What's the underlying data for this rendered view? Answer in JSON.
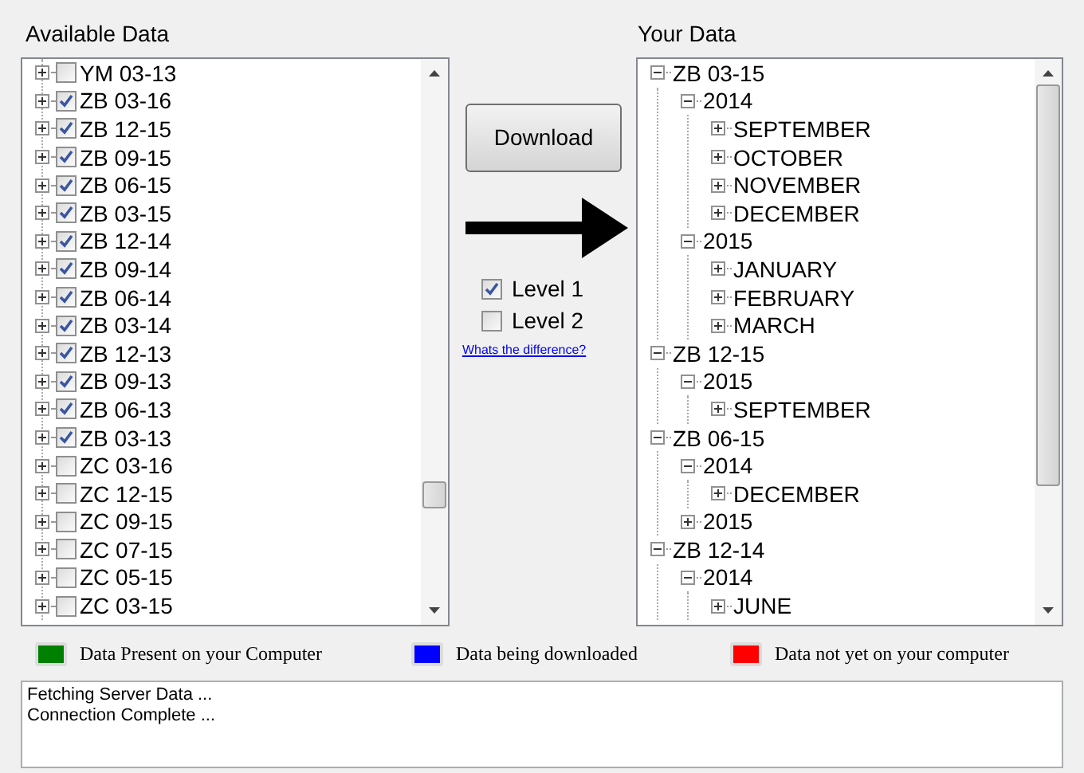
{
  "available_data": {
    "title": "Available Data",
    "items": [
      {
        "label": "YM 03-13",
        "checked": false
      },
      {
        "label": "ZB 03-16",
        "checked": true
      },
      {
        "label": "ZB 12-15",
        "checked": true
      },
      {
        "label": "ZB 09-15",
        "checked": true
      },
      {
        "label": "ZB 06-15",
        "checked": true
      },
      {
        "label": "ZB 03-15",
        "checked": true
      },
      {
        "label": "ZB 12-14",
        "checked": true
      },
      {
        "label": "ZB 09-14",
        "checked": true
      },
      {
        "label": "ZB 06-14",
        "checked": true
      },
      {
        "label": "ZB 03-14",
        "checked": true
      },
      {
        "label": "ZB 12-13",
        "checked": true
      },
      {
        "label": "ZB 09-13",
        "checked": true
      },
      {
        "label": "ZB 06-13",
        "checked": true
      },
      {
        "label": "ZB 03-13",
        "checked": true
      },
      {
        "label": "ZC 03-16",
        "checked": false
      },
      {
        "label": "ZC 12-15",
        "checked": false
      },
      {
        "label": "ZC 09-15",
        "checked": false
      },
      {
        "label": "ZC 07-15",
        "checked": false
      },
      {
        "label": "ZC 05-15",
        "checked": false
      },
      {
        "label": "ZC 03-15",
        "checked": false
      }
    ]
  },
  "download_button": "Download",
  "levels": [
    {
      "label": "Level 1",
      "checked": true
    },
    {
      "label": "Level 2",
      "checked": false
    }
  ],
  "difference_link": "Whats the difference?",
  "your_data": {
    "title": "Your Data",
    "tree": [
      {
        "label": "ZB 03-15",
        "expanded": true,
        "children": [
          {
            "label": "2014",
            "expanded": true,
            "children": [
              {
                "label": "SEPTEMBER",
                "expanded": false
              },
              {
                "label": "OCTOBER",
                "expanded": false
              },
              {
                "label": "NOVEMBER",
                "expanded": false
              },
              {
                "label": "DECEMBER",
                "expanded": false
              }
            ]
          },
          {
            "label": "2015",
            "expanded": true,
            "children": [
              {
                "label": "JANUARY",
                "expanded": false
              },
              {
                "label": "FEBRUARY",
                "expanded": false
              },
              {
                "label": "MARCH",
                "expanded": false
              }
            ]
          }
        ]
      },
      {
        "label": "ZB 12-15",
        "expanded": true,
        "children": [
          {
            "label": "2015",
            "expanded": true,
            "children": [
              {
                "label": "SEPTEMBER",
                "expanded": false
              }
            ]
          }
        ]
      },
      {
        "label": "ZB 06-15",
        "expanded": true,
        "children": [
          {
            "label": "2014",
            "expanded": true,
            "children": [
              {
                "label": "DECEMBER",
                "expanded": false
              }
            ]
          },
          {
            "label": "2015",
            "expanded": false
          }
        ]
      },
      {
        "label": "ZB 12-14",
        "expanded": true,
        "children": [
          {
            "label": "2014",
            "expanded": true,
            "children": [
              {
                "label": "JUNE",
                "expanded": false
              }
            ]
          }
        ]
      }
    ]
  },
  "legend": [
    {
      "label": "Data Present on your Computer",
      "color": "#008000"
    },
    {
      "label": "Data being downloaded",
      "color": "#0000ff"
    },
    {
      "label": "Data not yet on your computer",
      "color": "#ff0000"
    }
  ],
  "log": [
    "Fetching Server Data ...",
    "Connection Complete ..."
  ]
}
